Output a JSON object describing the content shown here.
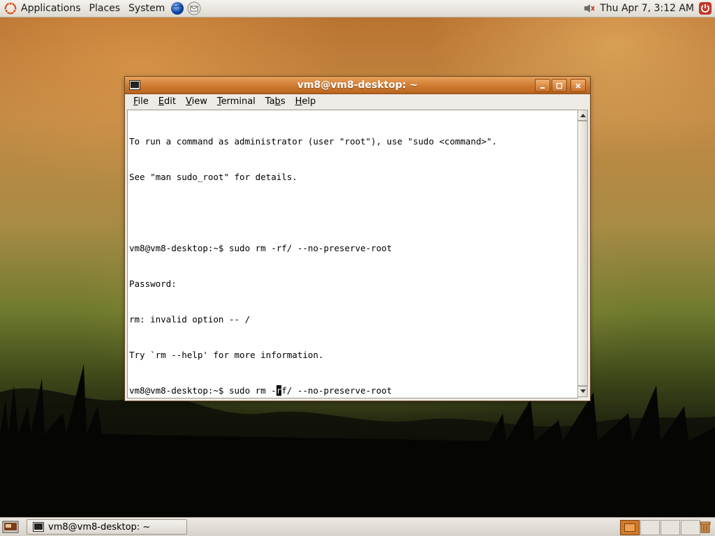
{
  "top_panel": {
    "menus": [
      "Applications",
      "Places",
      "System"
    ],
    "launchers": [
      "globe-icon",
      "mail-icon"
    ],
    "clock": "Thu Apr  7,  3:12 AM"
  },
  "window": {
    "title": "vm8@vm8-desktop: ~",
    "menu": [
      {
        "u": "F",
        "rest": "ile"
      },
      {
        "u": "E",
        "rest": "dit"
      },
      {
        "u": "V",
        "rest": "iew"
      },
      {
        "u": "T",
        "rest": "erminal"
      },
      {
        "pre": "Ta",
        "u": "b",
        "rest": "s"
      },
      {
        "u": "H",
        "rest": "elp"
      }
    ],
    "terminal_lines": [
      "To run a command as administrator (user \"root\"), use \"sudo <command>\".",
      "See \"man sudo_root\" for details.",
      "",
      "vm8@vm8-desktop:~$ sudo rm -rf/ --no-preserve-root",
      "Password:",
      "rm: invalid option -- /",
      "Try `rm --help' for more information."
    ],
    "current_line": {
      "before": "vm8@vm8-desktop:~$ sudo rm -",
      "cursor": "r",
      "after": "f/ --no-preserve-root"
    }
  },
  "bottom_panel": {
    "task": "vm8@vm8-desktop: ~",
    "workspaces": 4,
    "active_workspace": 1
  },
  "colors": {
    "title_bar": "#d17e34",
    "panel": "#e5e1d9"
  }
}
